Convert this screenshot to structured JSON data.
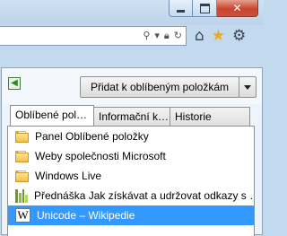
{
  "window": {
    "caption_buttons": [
      "minimize",
      "maximize",
      "close"
    ],
    "close_glyph": "✕"
  },
  "address_bar": {
    "icons": [
      "search-icon",
      "dropdown-icon",
      "lock-icon",
      "refresh-icon"
    ]
  },
  "toolbar": {
    "icons": [
      "home-icon",
      "favorites-star-icon",
      "tools-gear-icon"
    ],
    "accent_star": "#f0a81c"
  },
  "favorites_panel": {
    "add_button_label": "Přidat k oblíbeným položkám",
    "tabs": [
      {
        "label": "Oblíbené pol…",
        "active": true
      },
      {
        "label": "Informační k…",
        "active": false
      },
      {
        "label": "Historie",
        "active": false
      }
    ],
    "items": [
      {
        "label": "Panel Oblíbené položky",
        "icon": "folder-icon"
      },
      {
        "label": "Weby společnosti Microsoft",
        "icon": "folder-icon"
      },
      {
        "label": "Windows Live",
        "icon": "folder-icon"
      },
      {
        "label": "Přednáška Jak získávat a udržovat odkazy s …",
        "icon": "library-favicon"
      },
      {
        "label": "Unicode – Wikipedie",
        "icon": "wikipedia-favicon",
        "selected": true
      }
    ],
    "selection_color": "#3399ff"
  }
}
